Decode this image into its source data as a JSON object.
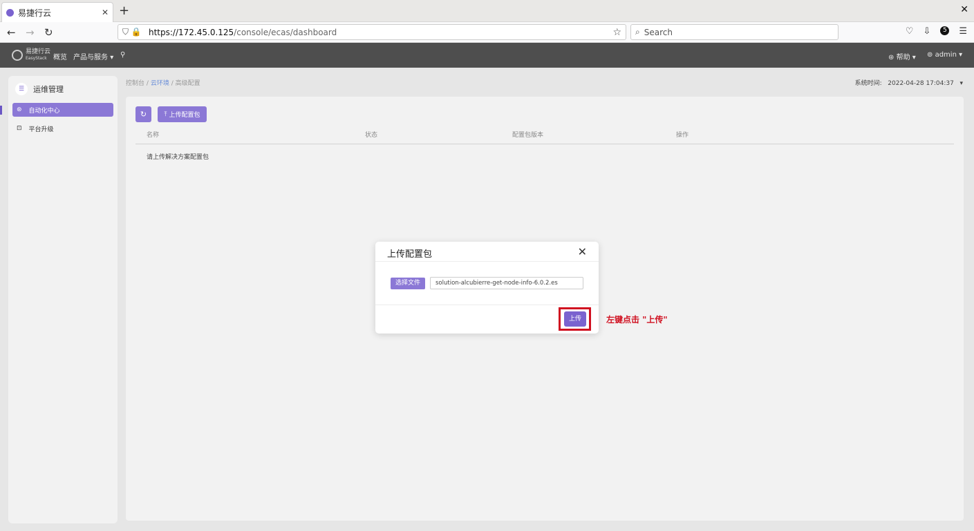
{
  "browser": {
    "tab_title": "易捷行云",
    "tab_close": "✕",
    "new_tab": "+",
    "window_close": "✕",
    "url_host": "https://172.45.0.125",
    "url_path": "/console/ecas/dashboard",
    "search_placeholder": "Search",
    "extension_badge": "5"
  },
  "app_header": {
    "logo_text": "易捷行云",
    "logo_sub": "EasyStack",
    "nav_overview": "概览",
    "nav_products": "产品与服务",
    "help": "帮助",
    "user": "admin"
  },
  "sidebar": {
    "title": "运维管理",
    "items": [
      {
        "label": "自动化中心",
        "active": true
      },
      {
        "label": "平台升级",
        "active": false
      }
    ]
  },
  "breadcrumb": {
    "home": "控制台",
    "cloud": "云环境",
    "current": "高级配置",
    "sep": "/"
  },
  "system_time": {
    "label": "系统时间:",
    "value": "2022-04-28 17:04:37"
  },
  "toolbar": {
    "upload_label": "上传配置包"
  },
  "table": {
    "columns": [
      "名称",
      "状态",
      "配置包版本",
      "操作"
    ],
    "empty_text": "请上传解决方案配置包"
  },
  "modal": {
    "title": "上传配置包",
    "choose_file": "选择文件",
    "file_name": "solution-alcubierre-get-node-info-6.0.2.es",
    "upload_button": "上传"
  },
  "annotation": {
    "text": "左键点击 \"上传\"",
    "color": "#d01020"
  },
  "colors": {
    "accent": "#8b78d6",
    "header_bg": "#4e4e4e"
  }
}
